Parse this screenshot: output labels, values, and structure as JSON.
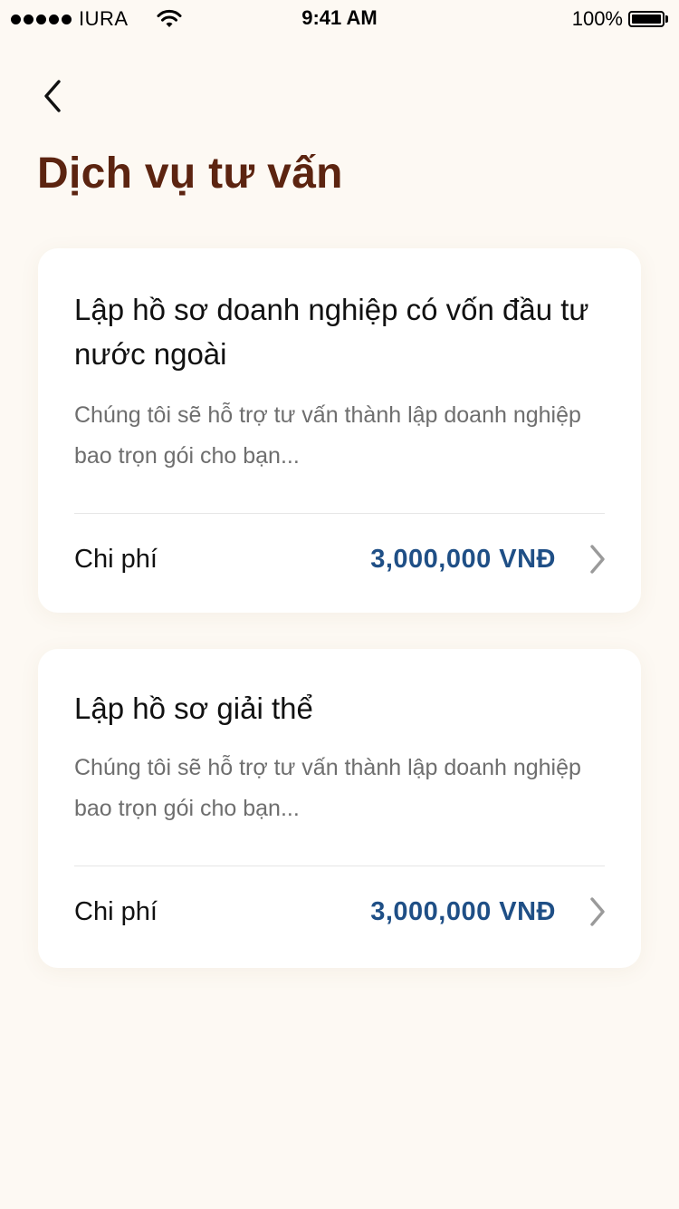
{
  "status_bar": {
    "carrier": "IURA",
    "time": "9:41 AM",
    "battery": "100%"
  },
  "header": {
    "back_icon": "chevron-left-icon",
    "title": "Dịch vụ tư vấn"
  },
  "services": [
    {
      "title": "Lập hồ sơ doanh nghiệp có vốn đầu tư nước ngoài",
      "description": "Chúng tôi sẽ hỗ trợ tư vấn thành lập doanh nghiệp bao trọn gói cho bạn...",
      "cost_label": "Chi phí",
      "cost_value": "3,000,000 VNĐ"
    },
    {
      "title": "Lập hồ sơ giải thể",
      "description": "Chúng tôi sẽ hỗ trợ tư vấn thành lập doanh nghiệp bao trọn gói cho bạn...",
      "cost_label": "Chi phí",
      "cost_value": "3,000,000 VNĐ"
    }
  ],
  "colors": {
    "background": "#fdf9f3",
    "title": "#5c2410",
    "price": "#1f4f86",
    "chevron": "#9a9a9a"
  }
}
